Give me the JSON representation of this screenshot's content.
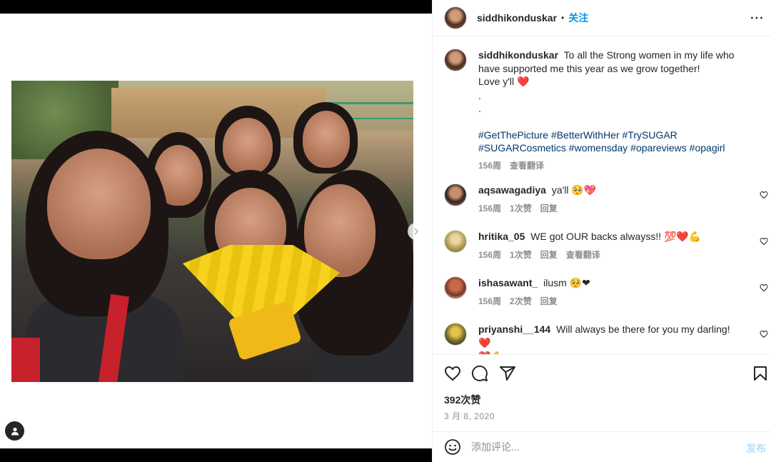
{
  "post": {
    "username": "siddhikonduskar",
    "dot": "•",
    "follow_label": "关注",
    "more_icon": "more-horizontal-icon"
  },
  "caption": {
    "username": "siddhikonduskar",
    "text_line1": "To all the Strong women in my life who have supported me this year as we grow together!",
    "text_line2": "Love y'll",
    "heart_emoji": "❤️",
    "dot1": ".",
    "dot2": ".",
    "hashtags": "#GetThePicture #BetterWithHer #TrySUGAR #SUGARCosmetics #womensday #opareviews #opagirl",
    "time": "156周",
    "translate": "查看翻译"
  },
  "comments": [
    {
      "username": "aqsawagadiya",
      "text": "ya'll",
      "emojis": "🥺💖",
      "time": "156周",
      "likes": "1次赞",
      "reply": "回复",
      "translate": ""
    },
    {
      "username": "hritika_05",
      "text": "WE got OUR backs alwayss!!",
      "emojis": "💯❤️💪",
      "time": "156周",
      "likes": "1次赞",
      "reply": "回复",
      "translate": "查看翻译"
    },
    {
      "username": "ishasawant_",
      "text": "ilusm",
      "emojis": "🥺❤",
      "time": "156周",
      "likes": "2次赞",
      "reply": "回复",
      "translate": ""
    },
    {
      "username": "priyanshi__144",
      "text": "Will always be there for you my darling!",
      "emojis": "❤️",
      "emojis2": "❤️💪",
      "time": "",
      "likes": "",
      "reply": "",
      "translate": ""
    }
  ],
  "footer": {
    "likes_count": "392次赞",
    "date": "3 月 8, 2020",
    "comment_placeholder": "添加评论...",
    "post_label": "发布"
  }
}
